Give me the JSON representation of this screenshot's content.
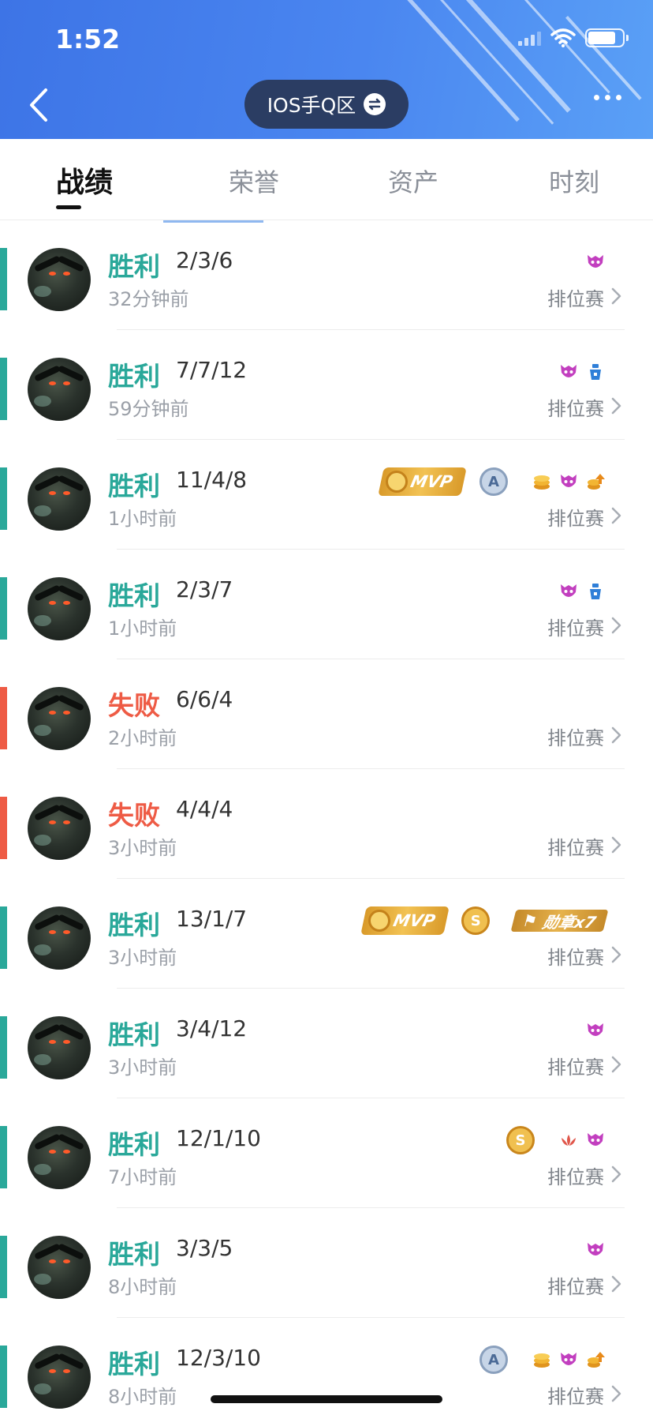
{
  "status_bar": {
    "time": "1:52"
  },
  "header": {
    "region_label": "IOS手Q区"
  },
  "tabs": [
    {
      "label": "战绩",
      "active": true
    },
    {
      "label": "荣誉",
      "active": false
    },
    {
      "label": "资产",
      "active": false
    },
    {
      "label": "时刻",
      "active": false
    }
  ],
  "colors": {
    "win": "#2aa89a",
    "loss": "#ee5b45",
    "header_blue": "#4a86f0",
    "pill": "#2b3d63"
  },
  "matches": [
    {
      "result": "胜利",
      "outcome": "win",
      "kda": "2/3/6",
      "time": "32分钟前",
      "mode": "排位赛",
      "badges": [
        "demon-icon"
      ]
    },
    {
      "result": "胜利",
      "outcome": "win",
      "kda": "7/7/12",
      "time": "59分钟前",
      "mode": "排位赛",
      "badges": [
        "demon-icon",
        "tower-icon"
      ]
    },
    {
      "result": "胜利",
      "outcome": "win",
      "kda": "11/4/8",
      "time": "1小时前",
      "mode": "排位赛",
      "mvp": "MVP",
      "grade": "A",
      "badges": [
        "coins-icon",
        "demon-icon",
        "coin-up-icon"
      ]
    },
    {
      "result": "胜利",
      "outcome": "win",
      "kda": "2/3/7",
      "time": "1小时前",
      "mode": "排位赛",
      "badges": [
        "demon-icon",
        "tower-icon"
      ]
    },
    {
      "result": "失败",
      "outcome": "loss",
      "kda": "6/6/4",
      "time": "2小时前",
      "mode": "排位赛",
      "badges": []
    },
    {
      "result": "失败",
      "outcome": "loss",
      "kda": "4/4/4",
      "time": "3小时前",
      "mode": "排位赛",
      "badges": []
    },
    {
      "result": "胜利",
      "outcome": "win",
      "kda": "13/1/7",
      "time": "3小时前",
      "mode": "排位赛",
      "mvp": "MVP",
      "grade": "S",
      "medal": "勋章x7",
      "badges": []
    },
    {
      "result": "胜利",
      "outcome": "win",
      "kda": "3/4/12",
      "time": "3小时前",
      "mode": "排位赛",
      "badges": [
        "demon-icon"
      ]
    },
    {
      "result": "胜利",
      "outcome": "win",
      "kda": "12/1/10",
      "time": "7小时前",
      "mode": "排位赛",
      "grade": "S",
      "badges": [
        "lotus-icon",
        "demon-icon"
      ]
    },
    {
      "result": "胜利",
      "outcome": "win",
      "kda": "3/3/5",
      "time": "8小时前",
      "mode": "排位赛",
      "badges": [
        "demon-icon"
      ]
    },
    {
      "result": "胜利",
      "outcome": "win",
      "kda": "12/3/10",
      "time": "8小时前",
      "mode": "排位赛",
      "grade": "A",
      "badges": [
        "coins-icon",
        "demon-icon",
        "coin-up-icon"
      ]
    }
  ]
}
